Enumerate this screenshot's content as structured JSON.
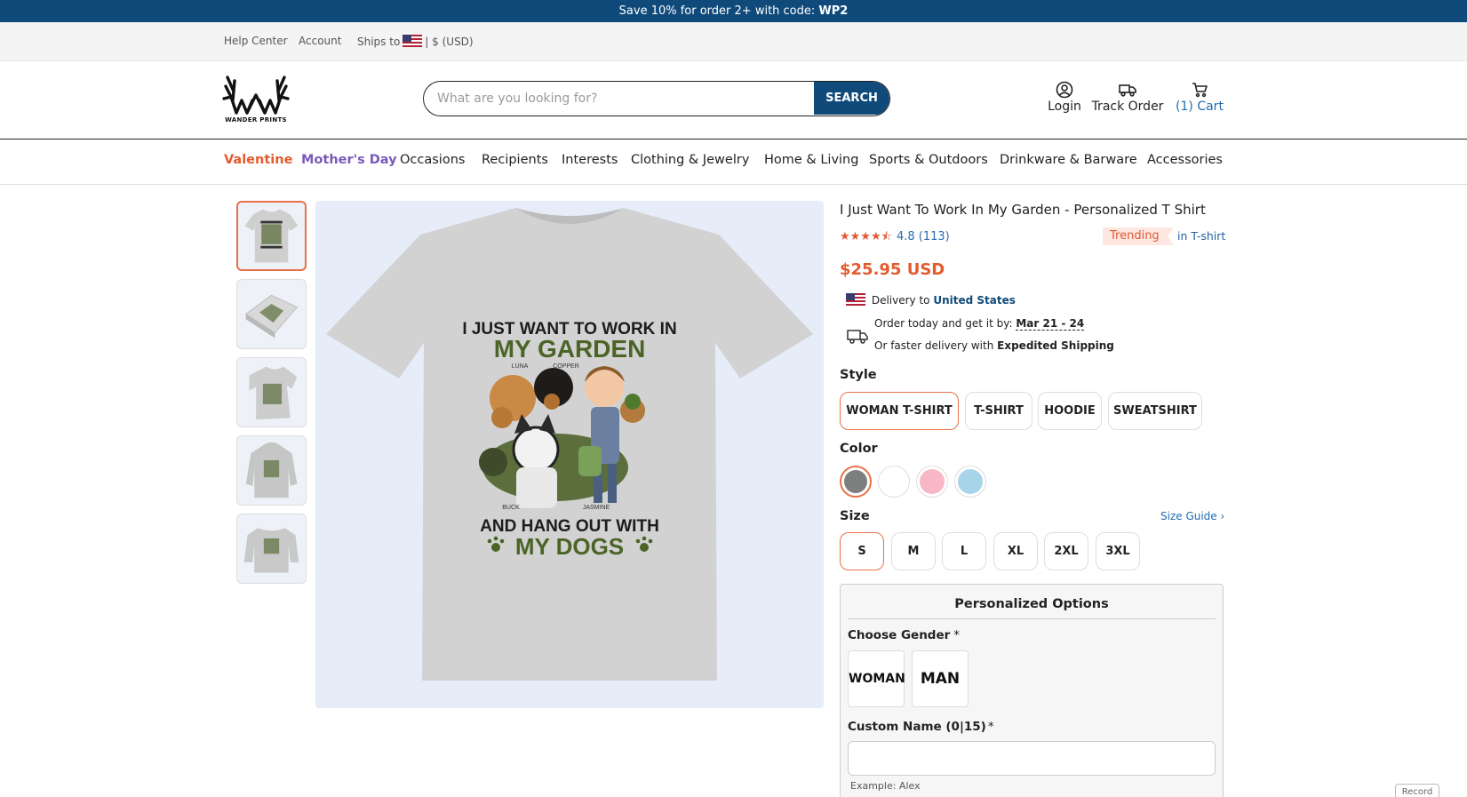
{
  "promo": {
    "text": "Save 10% for order 2+ with code: ",
    "code": "WP2"
  },
  "utility": {
    "help": "Help Center",
    "account": "Account",
    "ships_to": "Ships to",
    "currency": "| $ (USD)"
  },
  "brand": {
    "logo_text": "WANDER PRINTS"
  },
  "search": {
    "placeholder": "What are you looking for?",
    "button": "SEARCH"
  },
  "header_links": {
    "login": "Login",
    "track": "Track Order",
    "cart": "(1) Cart"
  },
  "nav": [
    "Valentine",
    "Mother's Day",
    "Occasions",
    "Recipients",
    "Interests",
    "Clothing & Jewelry",
    "Home & Living",
    "Sports & Outdoors",
    "Drinkware & Barware",
    "Accessories"
  ],
  "product": {
    "title": "I Just Want To Work In My Garden - Personalized T Shirt",
    "stars": "★★★★⯪",
    "rating": 4.8,
    "rating_text": "4.8 (113)",
    "reviews": 113,
    "badge": "Trending",
    "category": "in T-shirt",
    "price": "$25.95 USD"
  },
  "artwork": {
    "line1": "I JUST WANT TO WORK IN",
    "line2": "MY GARDEN",
    "line3": "AND HANG OUT WITH",
    "line4": "MY DOGS",
    "names": [
      "LUNA",
      "COPPER",
      "BUCK",
      "JASMINE"
    ]
  },
  "delivery": {
    "to_label": "Delivery to",
    "destination": "United States",
    "order_text": "Order today and get it by:",
    "date": "Mar 21 - 24",
    "faster_text": "Or faster delivery with",
    "faster_bold": "Expedited Shipping"
  },
  "style": {
    "label": "Style",
    "options": [
      "WOMAN T-SHIRT",
      "T-SHIRT",
      "HOODIE",
      "SWEATSHIRT"
    ],
    "selected": "WOMAN T-SHIRT"
  },
  "color": {
    "label": "Color",
    "swatches": [
      "#7c7f7d",
      "#ffffff",
      "#f7b7c4",
      "#a8d4ea"
    ],
    "selected_index": 0
  },
  "size": {
    "label": "Size",
    "guide": "Size Guide ›",
    "options": [
      "S",
      "M",
      "L",
      "XL",
      "2XL",
      "3XL"
    ],
    "selected": "S"
  },
  "personalized": {
    "title": "Personalized Options",
    "gender_label": "Choose Gender",
    "required_mark": "*",
    "genders": [
      "WOMAN",
      "MAN"
    ],
    "name_label": "Custom Name (0|15)",
    "example": "Example: Alex"
  },
  "record_label": "Record",
  "colors": {
    "accent": "#e35b2e",
    "brand": "#0f4a7a",
    "link": "#1f6cb0",
    "mothers_day": "#7a5ab8"
  }
}
